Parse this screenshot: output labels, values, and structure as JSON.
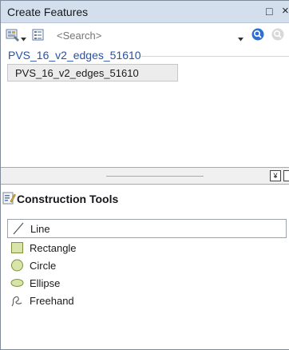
{
  "panel": {
    "title": "Create Features",
    "pin_glyph": "□",
    "close_glyph": "×"
  },
  "toolbar": {
    "search_placeholder": "<Search>",
    "icons": [
      "organize-templates-icon",
      "dropdown-arrow-icon",
      "view-options-icon",
      "search-dropdown-icon",
      "search-icon",
      "clear-search-icon"
    ]
  },
  "templates": {
    "group_label": "PVS_16_v2_edges_51610",
    "items": [
      {
        "label": "PVS_16_v2_edges_51610",
        "selected": true
      }
    ]
  },
  "splitter": {
    "toggle_glyph": "¥"
  },
  "construction_tools": {
    "title": "Construction Tools",
    "items": [
      {
        "label": "Line",
        "icon": "line-icon",
        "selected": true
      },
      {
        "label": "Rectangle",
        "icon": "rectangle-icon",
        "selected": false
      },
      {
        "label": "Circle",
        "icon": "circle-icon",
        "selected": false
      },
      {
        "label": "Ellipse",
        "icon": "ellipse-icon",
        "selected": false
      },
      {
        "label": "Freehand",
        "icon": "freehand-icon",
        "selected": false
      }
    ]
  },
  "colors": {
    "titlebar_bg": "#d4dfee",
    "group_label": "#2553a8",
    "shape_fill": "#d7e5a8",
    "shape_stroke": "#7e8f3e",
    "search_icon": "#2e6fd0"
  }
}
